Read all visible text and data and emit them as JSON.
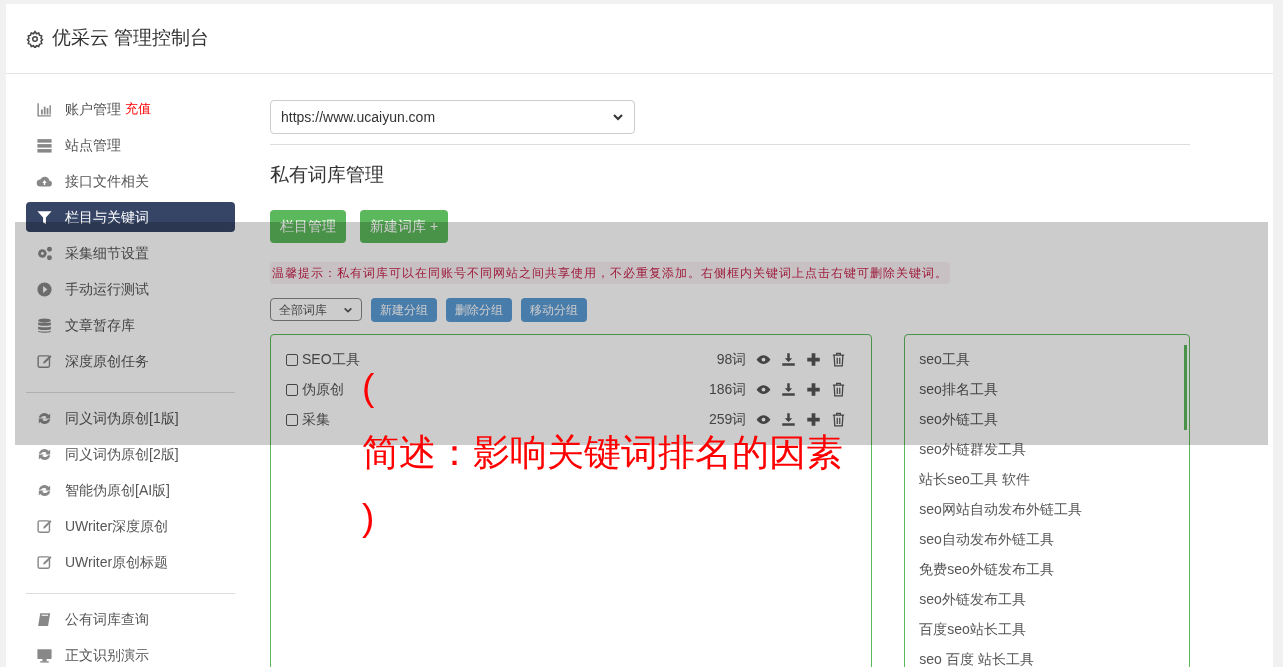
{
  "header": {
    "title": "优采云 管理控制台"
  },
  "sidebar": {
    "groups": [
      {
        "items": [
          {
            "label": "账户管理",
            "badge": "充值",
            "kind": "chart",
            "selected": false
          },
          {
            "label": "站点管理",
            "kind": "server",
            "selected": false
          },
          {
            "label": "接口文件相关",
            "kind": "cloud",
            "selected": false
          },
          {
            "label": "栏目与关键词",
            "kind": "filter",
            "selected": true
          },
          {
            "label": "采集细节设置",
            "kind": "gears",
            "selected": false
          },
          {
            "label": "手动运行测试",
            "kind": "play",
            "selected": false
          },
          {
            "label": "文章暂存库",
            "kind": "database",
            "selected": false
          },
          {
            "label": "深度原创任务",
            "kind": "edit",
            "selected": false
          }
        ]
      },
      {
        "items": [
          {
            "label": "同义词伪原创[1版]",
            "kind": "refresh",
            "selected": false
          },
          {
            "label": "同义词伪原创[2版]",
            "kind": "refresh",
            "selected": false
          },
          {
            "label": "智能伪原创[AI版]",
            "kind": "refresh",
            "selected": false
          },
          {
            "label": "UWriter深度原创",
            "kind": "edit",
            "selected": false
          },
          {
            "label": "UWriter原创标题",
            "kind": "edit",
            "selected": false
          }
        ]
      },
      {
        "items": [
          {
            "label": "公有词库查询",
            "kind": "book",
            "selected": false
          },
          {
            "label": "正文识别演示",
            "kind": "monitor",
            "selected": false
          }
        ]
      }
    ]
  },
  "site_select": {
    "value": "https://www.ucaiyun.com"
  },
  "page_title": "私有词库管理",
  "buttons": [
    "栏目管理",
    "新建词库 +"
  ],
  "notice": "温馨提示：私有词库可以在同账号不同网站之间共享使用，不必重复添加。右侧框内关键词上点击右键可删除关键词。",
  "group_select": {
    "value": "全部词库"
  },
  "group_buttons": [
    "新建分组",
    "删除分组",
    "移动分组"
  ],
  "libraries": [
    {
      "name": "SEO工具",
      "count": "98词",
      "checked": false
    },
    {
      "name": "伪原创",
      "count": "186词",
      "checked": false
    },
    {
      "name": "采集",
      "count": "259词",
      "checked": false
    }
  ],
  "keywords": [
    "seo工具",
    "seo排名工具",
    "seo外链工具",
    "seo外链群发工具",
    "站长seo工具 软件",
    "seo网站自动发布外链工具",
    "seo自动发布外链工具",
    "免费seo外链发布工具",
    "seo外链发布工具",
    "百度seo站长工具",
    "seo 百度 站长工具"
  ],
  "overlay": {
    "open": "(",
    "title": "简述：影响关键词排名的因素",
    "close": ")"
  }
}
